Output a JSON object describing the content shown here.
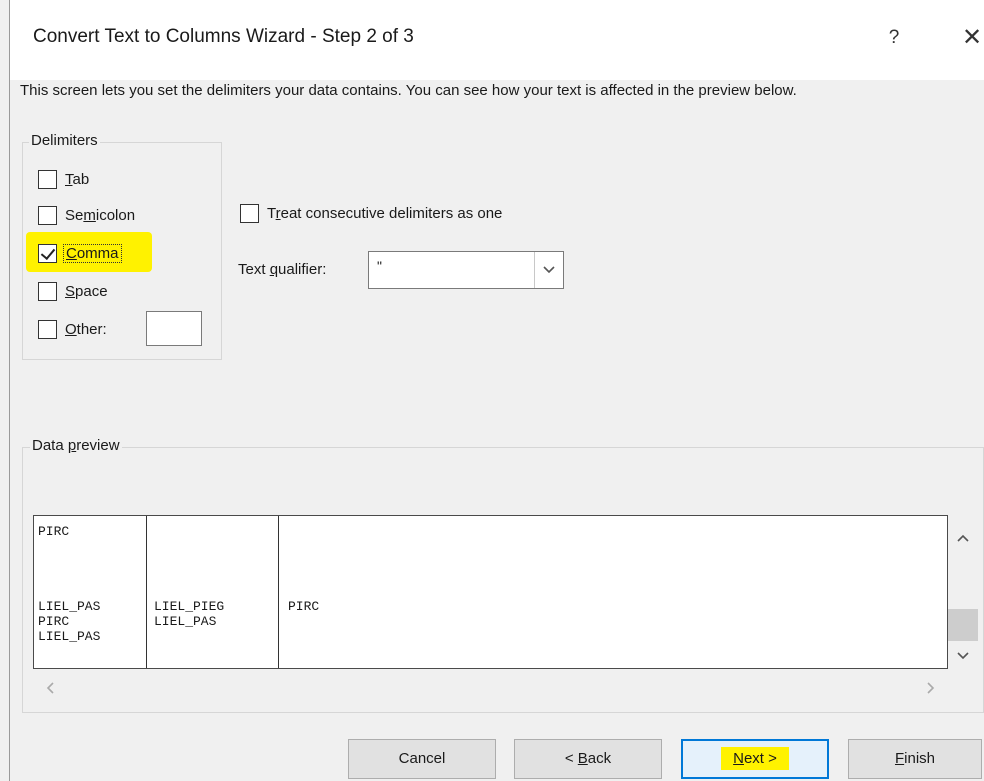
{
  "window": {
    "title": "Convert Text to Columns Wizard - Step 2 of 3",
    "help_glyph": "?",
    "close_glyph": "✕"
  },
  "intro_text": "This screen lets you set the delimiters your data contains.  You can see how your text is affected in the preview below.",
  "delimiters": {
    "legend": "Delimiters",
    "items": [
      {
        "pre": "",
        "acc": "T",
        "post": "ab",
        "checked": false
      },
      {
        "pre": "Se",
        "acc": "m",
        "post": "icolon",
        "checked": false
      },
      {
        "pre": "",
        "acc": "C",
        "post": "omma",
        "checked": true
      },
      {
        "pre": "",
        "acc": "S",
        "post": "pace",
        "checked": false
      },
      {
        "pre": "",
        "acc": "O",
        "post": "ther:",
        "checked": false
      }
    ],
    "other_value": ""
  },
  "consecutive": {
    "pre": "T",
    "acc": "r",
    "post": "eat consecutive delimiters as one",
    "checked": false
  },
  "qualifier": {
    "pre": "Text ",
    "acc": "q",
    "post": "ualifier:",
    "value": "\""
  },
  "preview": {
    "legend_pre": "Data ",
    "legend_acc": "p",
    "legend_post": "review",
    "columns": [
      "PIRC\n\n\n\n\nLIEL_PAS\nPIRC\nLIEL_PAS",
      "\n\n\n\n\nLIEL_PIEG\nLIEL_PAS",
      "\n\n\n\n\nPIRC"
    ]
  },
  "buttons": {
    "cancel": "Cancel",
    "back_pre": "< ",
    "back_acc": "B",
    "back_post": "ack",
    "next_acc": "N",
    "next_post": "ext >",
    "finish_acc": "F",
    "finish_post": "inish"
  },
  "highlight_color": "#fff200",
  "accent_color": "#0078d7"
}
